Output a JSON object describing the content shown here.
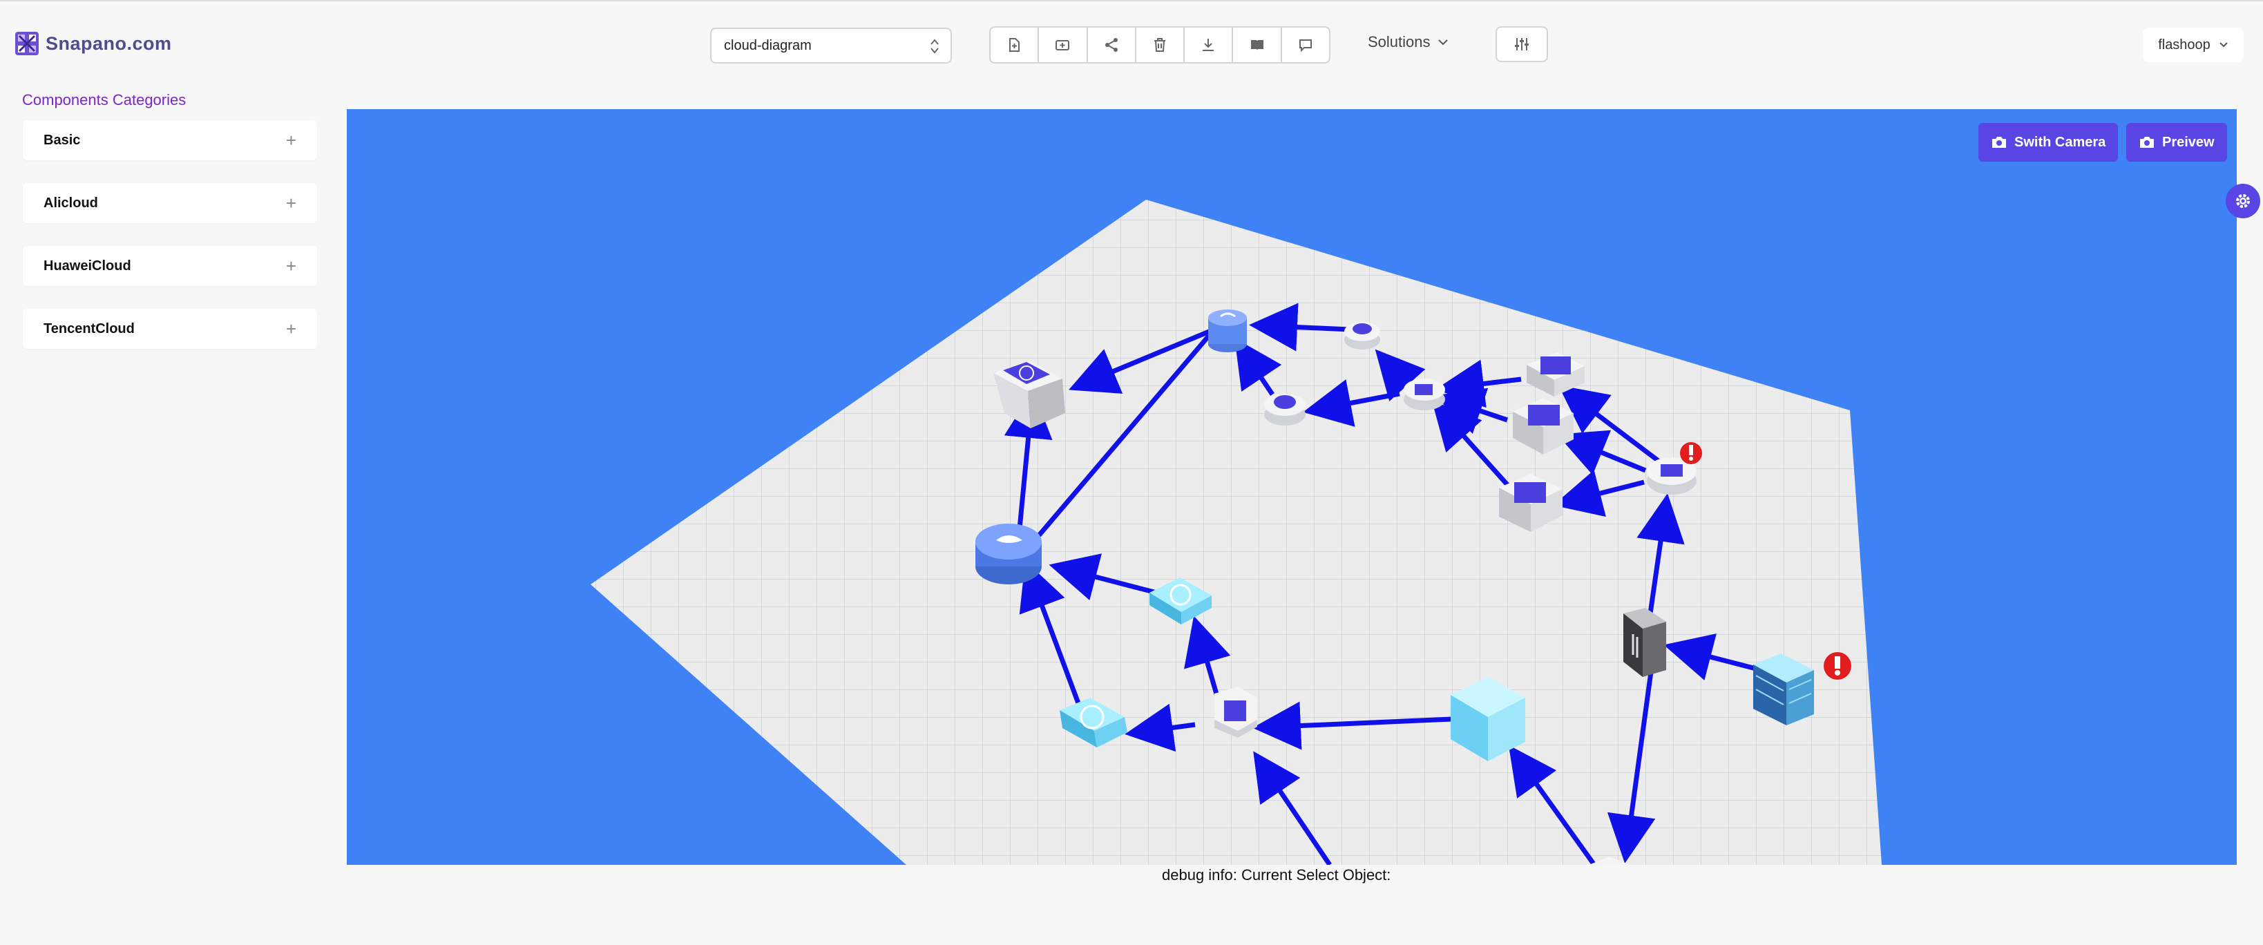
{
  "header": {
    "logo_text": "Snapano.com",
    "diagram_select": {
      "value": "cloud-diagram"
    },
    "toolbar_icons": [
      "new-file-icon",
      "add-model-icon",
      "share-icon",
      "delete-icon",
      "download-icon",
      "book-icon",
      "comment-icon"
    ],
    "solutions_label": "Solutions",
    "user_label": "flashoop"
  },
  "sidebar": {
    "title": "Components Categories",
    "categories": [
      {
        "label": "Basic"
      },
      {
        "label": "Alicloud"
      },
      {
        "label": "HuaweiCloud"
      },
      {
        "label": "TencentCloud"
      }
    ]
  },
  "canvas": {
    "background": "#3f82f6",
    "switch_camera_label": "Swith Camera",
    "preview_label": "Preivew",
    "accent": "#5945e4",
    "edge_color": "#1010e8",
    "warning_color": "#e11d1d"
  },
  "debug": {
    "label": "debug info: Current Select Object:"
  }
}
